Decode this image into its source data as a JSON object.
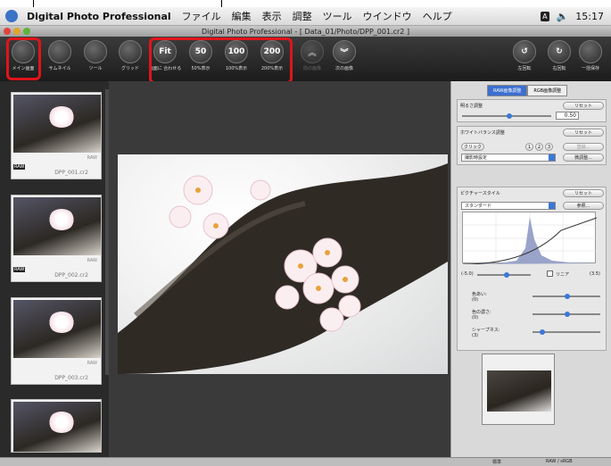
{
  "menubar": {
    "app_name": "Digital Photo Professional",
    "menus": [
      "ファイル",
      "編集",
      "表示",
      "調整",
      "ツール",
      "ウインドウ",
      "ヘルプ"
    ],
    "time": "15:17"
  },
  "window": {
    "title": "Digital Photo Professional - [ Data_01/Photo/DPP_001.cr2 ]"
  },
  "toolbar": {
    "buttons": [
      {
        "label": "メイン画面",
        "glyph": ""
      },
      {
        "label": "サムネイル",
        "glyph": ""
      },
      {
        "label": "ツール",
        "glyph": ""
      },
      {
        "label": "グリッド",
        "glyph": ""
      },
      {
        "label": "画面に 合わせる",
        "glyph": "Fit"
      },
      {
        "label": "50%表示",
        "glyph": "50"
      },
      {
        "label": "100%表示",
        "glyph": "100"
      },
      {
        "label": "200%表示",
        "glyph": "200"
      },
      {
        "label": "前の画像",
        "glyph": "︽"
      },
      {
        "label": "次の画像",
        "glyph": "︾"
      },
      {
        "label": "左回転",
        "glyph": "↺"
      },
      {
        "label": "右回転",
        "glyph": "↻"
      },
      {
        "label": "一括保存",
        "glyph": ""
      }
    ]
  },
  "thumbnails": [
    {
      "name": "DPP_001.cr2",
      "badge": "RAW",
      "tag": "RAW"
    },
    {
      "name": "DPP_002.cr2",
      "badge": "RAW",
      "tag": "RAW"
    },
    {
      "name": "DPP_003.cr2",
      "badge": "RAW",
      "tag": ""
    },
    {
      "name": "",
      "badge": "",
      "tag": ""
    }
  ],
  "right_panel": {
    "tabs": [
      "RAW画像調整",
      "RGB画像調整"
    ],
    "brightness": {
      "title": "明るさ調整",
      "reset": "リセット",
      "value": "0.50"
    },
    "white_balance": {
      "title": "ホワイトバランス調整",
      "reset": "リセット",
      "click": "クリック",
      "nums": [
        "1",
        "2",
        "3"
      ],
      "register": "登録...",
      "preset": "撮影時設定",
      "fine": "微調整..."
    },
    "picture_style": {
      "title": "ピクチャースタイル",
      "reset": "リセット",
      "style": "スタンダード",
      "ref": "参照...",
      "range_min": "(-5.0)",
      "range_max": "(3.5)",
      "linear": "リニア",
      "params": [
        {
          "label": "色あい:",
          "value": "(0)"
        },
        {
          "label": "色の濃さ:",
          "value": "(0)"
        },
        {
          "label": "シャープネス:",
          "value": "(3)"
        }
      ]
    }
  },
  "status": {
    "left": "標準",
    "right": "RAW / sRGB"
  },
  "colors": {
    "highlight_red": "#e0141b",
    "accent_blue": "#3c6fcf"
  }
}
